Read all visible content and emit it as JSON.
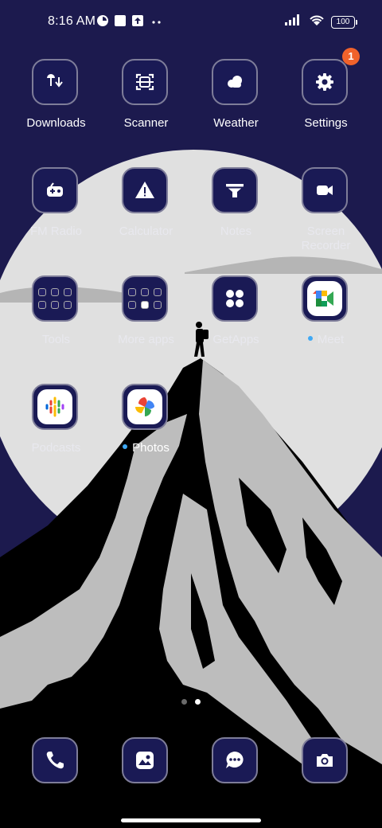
{
  "status_bar": {
    "time": "8:16 AM",
    "battery": "100",
    "icons": [
      "data-saver-icon",
      "square-notification-icon",
      "upload-notification-icon",
      "more-dots-icon",
      "signal-icon",
      "wifi-icon",
      "battery-icon"
    ]
  },
  "apps": {
    "downloads": "Downloads",
    "scanner": "Scanner",
    "weather": "Weather",
    "settings": "Settings",
    "settings_badge": "1",
    "fm_radio": "FM Radio",
    "calculator": "Calculator",
    "notes": "Notes",
    "screen_recorder_line1": "Screen",
    "screen_recorder_line2": "Recorder",
    "tools": "Tools",
    "more_apps": "More apps",
    "getapps": "GetApps",
    "meet": "Meet",
    "podcasts": "Podcasts",
    "photos": "Photos"
  },
  "dock": {
    "items": [
      "phone-icon",
      "gallery-icon",
      "messages-icon",
      "camera-icon"
    ]
  },
  "pages": {
    "count": 2,
    "active_index": 1
  },
  "colors": {
    "background": "#1c1a4e",
    "moon": "#e0e0e0",
    "mountain_dark": "#000000",
    "mountain_light": "#bdbdbd",
    "badge": "#f0622b",
    "new_dot": "#3fa8f4"
  }
}
